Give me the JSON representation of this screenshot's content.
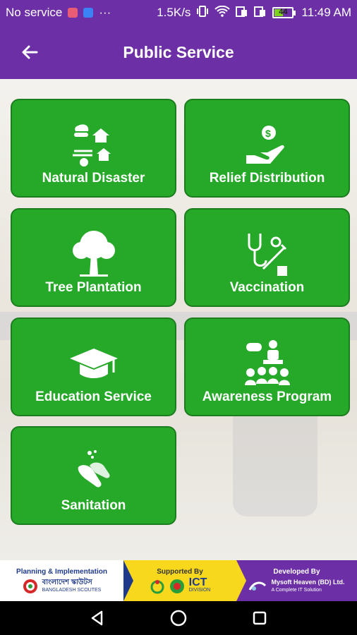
{
  "status_bar": {
    "carrier": "No service",
    "speed": "1.5K/s",
    "battery": "44",
    "battery_level": 0.44,
    "time": "11:49 AM",
    "colors": {
      "bar": "#6c2fa6",
      "battery_fill": "#7ed321"
    }
  },
  "app_bar": {
    "title": "Public Service",
    "back_icon": "arrow-left-icon"
  },
  "services": [
    {
      "label": "Natural Disaster",
      "icon": "natural-disaster-icon"
    },
    {
      "label": "Relief Distribution",
      "icon": "relief-hand-coin-icon"
    },
    {
      "label": "Tree Plantation",
      "icon": "tree-icon"
    },
    {
      "label": "Vaccination",
      "icon": "stethoscope-syringe-icon"
    },
    {
      "label": "Education Service",
      "icon": "graduation-cap-icon"
    },
    {
      "label": "Awareness Program",
      "icon": "speaker-audience-icon"
    },
    {
      "label": "Sanitation",
      "icon": "hand-washing-icon"
    }
  ],
  "colors": {
    "card": "#26a829",
    "card_border": "#1c7d1f",
    "accent": "#6c2fa6"
  },
  "footer_banner": {
    "planning": "Planning & Implementation",
    "scouts_bn": "বাংলাদেশ স্কাউটস",
    "scouts_en": "BANGLADESH SCOUTES",
    "supported": "Supported By",
    "ict": "ICT",
    "ict_sub": "DIVISION",
    "developed": "Developed By",
    "developer": "Mysoft Heaven (BD) Ltd.",
    "developer_sub": "A Complete IT Solution"
  },
  "nav_bar": {
    "back": "back-triangle-icon",
    "home": "home-circle-icon",
    "recents": "recents-square-icon"
  }
}
